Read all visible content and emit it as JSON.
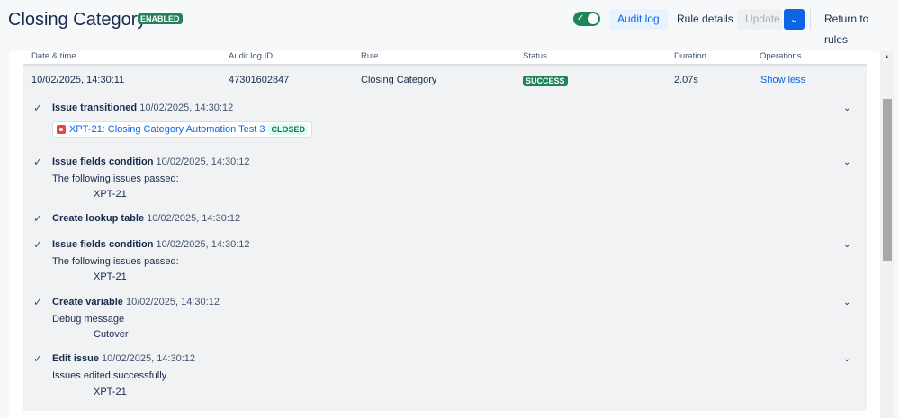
{
  "header": {
    "title": "Closing Category",
    "status_badge": "ENABLED",
    "toggle_on": true,
    "audit_log": "Audit log",
    "rule_details": "Rule details",
    "update": "Update",
    "return": "Return to rules"
  },
  "table": {
    "columns": [
      "Date & time",
      "Audit log ID",
      "Rule",
      "Status",
      "Duration",
      "Operations"
    ],
    "row": {
      "date": "10/02/2025, 14:30:11",
      "id": "47301602847",
      "rule": "Closing Category",
      "status": "SUCCESS",
      "duration": "2.07s",
      "operation": "Show less"
    }
  },
  "steps": [
    {
      "title": "Issue transitioned",
      "time": "10/02/2025, 14:30:12",
      "issue": {
        "link": "XPT-21: Closing Category Automation Test 3",
        "status": "CLOSED"
      }
    },
    {
      "title": "Issue fields condition",
      "time": "10/02/2025, 14:30:12",
      "label": "The following issues passed:",
      "value": "XPT-21"
    },
    {
      "title": "Create lookup table",
      "time": "10/02/2025, 14:30:12"
    },
    {
      "title": "Issue fields condition",
      "time": "10/02/2025, 14:30:12",
      "label": "The following issues passed:",
      "value": "XPT-21"
    },
    {
      "title": "Create variable",
      "time": "10/02/2025, 14:30:12",
      "label": "Debug message",
      "value": "Cutover"
    },
    {
      "title": "Edit issue",
      "time": "10/02/2025, 14:30:12",
      "label": "Issues edited successfully",
      "value": "XPT-21"
    }
  ]
}
